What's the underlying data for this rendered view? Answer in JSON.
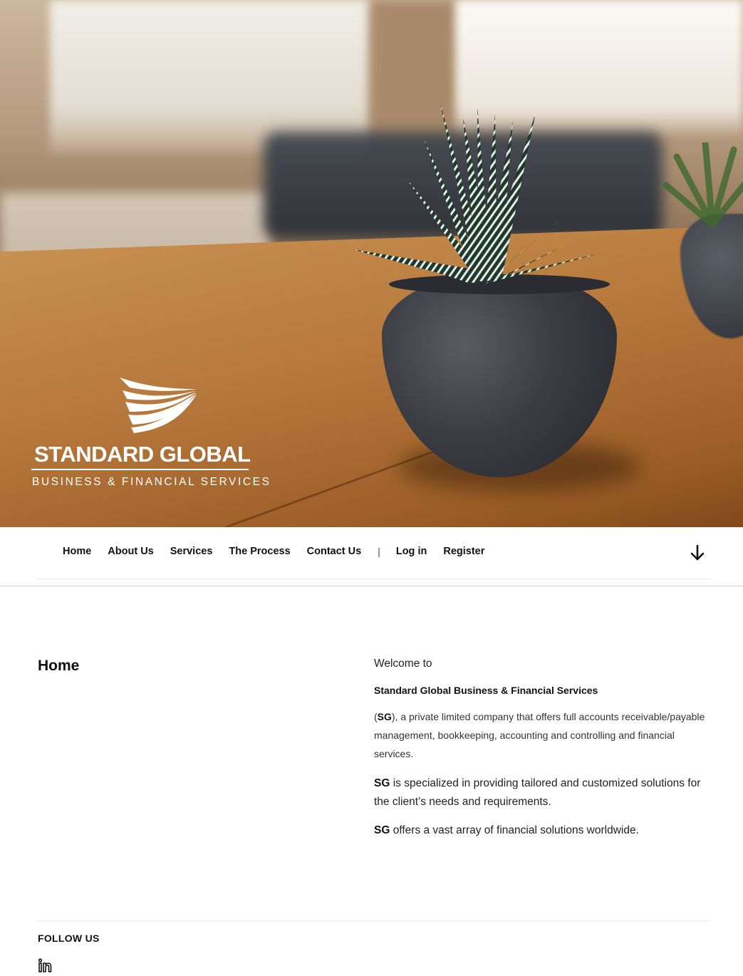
{
  "brand": {
    "name": "STANDARD GLOBAL",
    "tagline": "BUSINESS & FINANCIAL SERVICES"
  },
  "nav": {
    "items": [
      {
        "label": "Home"
      },
      {
        "label": "About Us"
      },
      {
        "label": "Services"
      },
      {
        "label": "The Process"
      },
      {
        "label": "Contact Us"
      }
    ],
    "separator": "|",
    "login": "Log in",
    "register": "Register",
    "scroll_icon": "arrow-down-icon"
  },
  "main": {
    "title": "Home",
    "welcome": "Welcome to",
    "company_name": "Standard Global Business & Financial Services",
    "intro_abbr": "SG",
    "intro_open": "(",
    "intro_rest": "), a private limited company that offers full accounts receivable/payable management, bookkeeping, accounting and controlling and financial services.",
    "para1_abbr": "SG",
    "para1_rest": " is specialized in providing tailored and customized solutions for the client’s needs and requirements.",
    "para2_abbr": "SG",
    "para2_rest": " offers a vast array of financial solutions worldwide."
  },
  "footer": {
    "follow_label": "FOLLOW US",
    "social_icon": "linkedin-icon"
  },
  "colors": {
    "separator": "#8a2c4a",
    "text": "#111111"
  }
}
